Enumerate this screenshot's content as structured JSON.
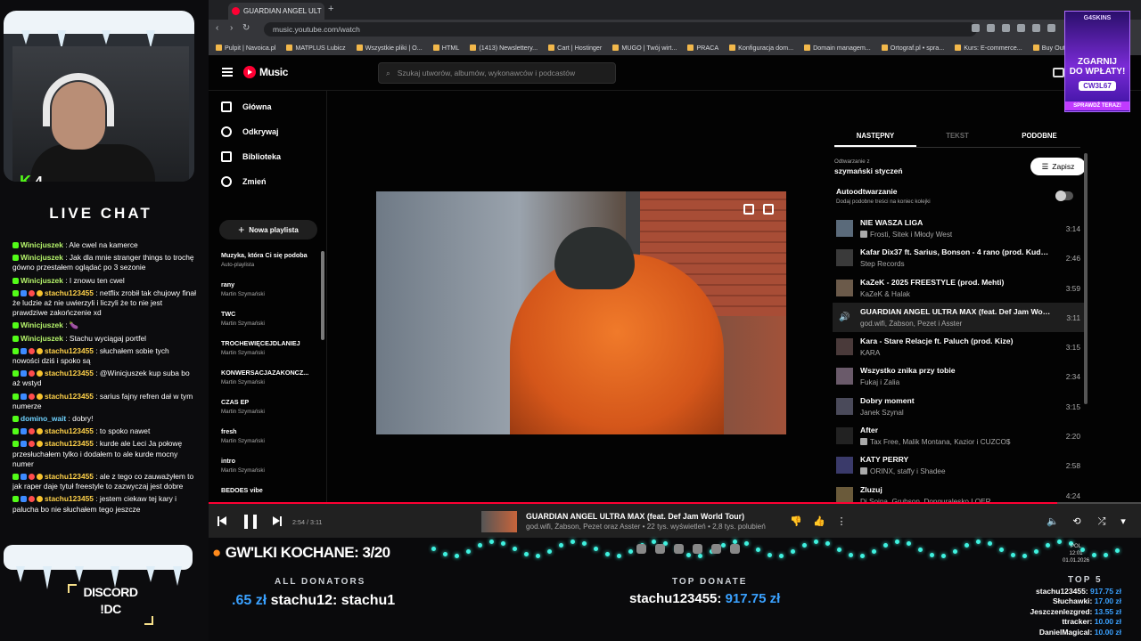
{
  "overlay": {
    "kick_count": "4",
    "live_chat_title": "LIVE CHAT",
    "chat": [
      {
        "user": "Winicjuszek",
        "text": ": Ale cwel na kamerce"
      },
      {
        "user": "Winicjuszek",
        "text": ": Jak dla mnie stranger things to trochę gówno przestałem oglądać po 3 sezonie"
      },
      {
        "user": "Winicjuszek",
        "text": ": I znowu ten cwel"
      },
      {
        "user": "stachu123455",
        "text": ": netflix zrobił tak chujowy finał że ludzie aż nie uwierzyli i liczyli że to nie jest prawdziwe zakończenie xd"
      },
      {
        "user": "Winicjuszek",
        "text": ": 🍆"
      },
      {
        "user": "Winicjuszek",
        "text": ": Stachu wyciągaj portfel"
      },
      {
        "user": "stachu123455",
        "text": ": słuchałem sobie tych nowości dziś i spoko są"
      },
      {
        "user": "stachu123455",
        "text": ": @Winicjuszek kup suba bo aż wstyd"
      },
      {
        "user": "stachu123455",
        "text": ": sarius fajny refren dał w tym numerze"
      },
      {
        "user": "domino_wait",
        "text": ": dobry!"
      },
      {
        "user": "stachu123455",
        "text": ": to spoko nawet"
      },
      {
        "user": "stachu123455",
        "text": ": kurde ale Leci Ja połowę przesłuchałem tylko i dodałem to ale kurde mocny numer"
      },
      {
        "user": "stachu123455",
        "text": ": ale z tego co zauważyłem to jak raper daje tytuł freestyle to zazwyczaj jest dobre"
      },
      {
        "user": "stachu123455",
        "text": ": jestem ciekaw tej kary i palucha bo nie słuchałem tego jeszcze"
      }
    ],
    "discord_line1": "DISCORD",
    "discord_line2": "!DC",
    "goal_text": "GW'LKI KOCHANE: 3/20",
    "all_donators_label": "ALL DONATORS",
    "all_donators_amount": ".65 zł",
    "all_donators_names": "stachu12: stachu1",
    "top_donate_label": "TOP DONATE",
    "top_donate_name": "stachu123455:",
    "top_donate_amount": "917.75 zł",
    "top5_label": "TOP 5",
    "top5": [
      {
        "name": "stachu123455:",
        "amount": "917.75 zł"
      },
      {
        "name": "Słuchawki:",
        "amount": "17.00 zł"
      },
      {
        "name": "Jeszczenlezgred:",
        "amount": "13.55 zł"
      },
      {
        "name": "ttracker:",
        "amount": "10.00 zł"
      },
      {
        "name": "DanielMagical:",
        "amount": "10.00 zł"
      }
    ],
    "clock": "12:01",
    "date": "01.01.2026",
    "lang": "POL",
    "ad": {
      "brand": "G4SKINS",
      "big1": "ZGARNIJ",
      "big2": "DO WPŁATY!",
      "code": "CW3L67",
      "cta": "SPRAWDŹ TERAZ!"
    }
  },
  "browser": {
    "tab_title": "GUARDIAN ANGEL ULT",
    "url": "music.youtube.com/watch",
    "bookmarks": [
      "Pulpit | Navoica.pl",
      "MATPLUS Lubicz",
      "Wszystkie pliki | O...",
      "HTML",
      "(1413) Newslettery...",
      "Cart | Hostinger",
      "MUGO | Twój wirt...",
      "PRACA",
      "Konfiguracja dom...",
      "Domain managem...",
      "Ortograf.pl • spra...",
      "Kurs: E-commerce...",
      "Buy Outla"
    ]
  },
  "ytm": {
    "logo": "Music",
    "search_placeholder": "Szukaj utworów, albumów, wykonawców i podcastów",
    "nav": [
      "Główna",
      "Odkrywaj",
      "Biblioteka",
      "Zmień"
    ],
    "new_playlist": "Nowa playlista",
    "playlists": [
      {
        "title": "Muzyka, która Ci się podoba",
        "sub": "Auto-playlista"
      },
      {
        "title": "rany",
        "sub": "Martin Szymański"
      },
      {
        "title": "TWC",
        "sub": "Martin Szymański"
      },
      {
        "title": "TROCHEWIĘCEJDLANIEJ",
        "sub": "Martin Szymański"
      },
      {
        "title": "KONWERSACJAZAKONCZ...",
        "sub": "Martin Szymański"
      },
      {
        "title": "CZAS EP",
        "sub": "Martin Szymański"
      },
      {
        "title": "fresh",
        "sub": "Martin Szymański"
      },
      {
        "title": "intro",
        "sub": "Martin Szymański"
      },
      {
        "title": "BEDOES vibe",
        "sub": ""
      }
    ],
    "tabs": [
      "NASTĘPNY",
      "TEKST",
      "PODOBNE"
    ],
    "playing_from_label": "Odtwarzanie z",
    "playing_from": "szymański styczeń",
    "save_label": "Zapisz",
    "autoplay_title": "Autoodtwarzanie",
    "autoplay_sub": "Dodaj podobne treści na koniec kolejki",
    "queue": [
      {
        "title": "NIE WASZA LIGA",
        "artist": "Frosti, Sitek i Młody West",
        "dur": "3:14",
        "explicit": true
      },
      {
        "title": "Kafar Dix37 ft. Sarius, Bonson - 4 rano (prod. Kudel, ...",
        "artist": "Step Records",
        "dur": "2:46",
        "explicit": false
      },
      {
        "title": "KaZeK - 2025 FREESTYLE (prod. Mehti)",
        "artist": "KaZeK & Halak",
        "dur": "3:59",
        "explicit": false
      },
      {
        "title": "GUARDIAN ANGEL ULTRA MAX (feat. Def Jam World...",
        "artist": "god.wifi, Żabson, Pezet i Asster",
        "dur": "3:11",
        "explicit": false,
        "active": true
      },
      {
        "title": "Kara - Stare Relacje ft. Paluch (prod. Kize)",
        "artist": "KARA",
        "dur": "3:15",
        "explicit": false
      },
      {
        "title": "Wszystko znika przy tobie",
        "artist": "Fukaj i Zalia",
        "dur": "2:34",
        "explicit": false
      },
      {
        "title": "Dobry moment",
        "artist": "Janek Szynal",
        "dur": "3:15",
        "explicit": false
      },
      {
        "title": "After",
        "artist": "Tax Free, Malik Montana, Kazior i CUZCO$",
        "dur": "2:20",
        "explicit": true
      },
      {
        "title": "KATY PERRY",
        "artist": "ORINX, staffy i Shadee",
        "dur": "2:58",
        "explicit": true
      },
      {
        "title": "Zluzuj",
        "artist": "Dj Soina, Grubson, Donguralesko LOER",
        "dur": "4:24",
        "explicit": false
      }
    ],
    "player": {
      "time": "2:54 / 3:11",
      "progress": 0.91,
      "title": "GUARDIAN ANGEL ULTRA MAX (feat. Def Jam World Tour)",
      "sub": "god.wifi, Żabson, Pezet oraz Asster • 22 tys. wyświetleń • 2,8 tys. polubień"
    }
  }
}
